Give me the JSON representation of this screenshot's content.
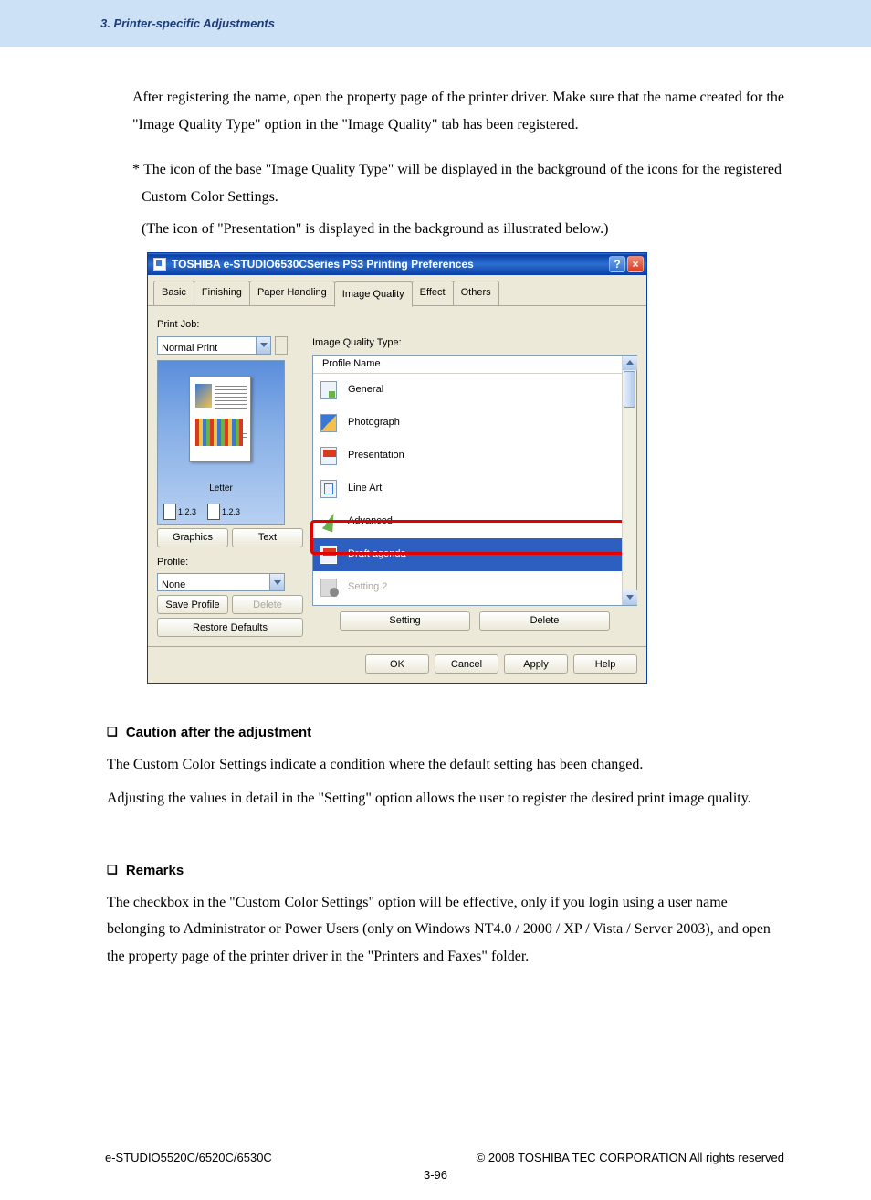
{
  "header": {
    "section": "3. Printer-specific Adjustments"
  },
  "body": {
    "para1": "After registering the name, open the property page of the printer driver.  Make sure that the name created for the \"Image Quality Type\" option in the \"Image Quality\" tab has been registered.",
    "star": "*",
    "para2a": "The icon of the base \"Image Quality Type\" will be displayed in the background of the icons for the registered Custom Color Settings.",
    "para2b": "(The icon of \"Presentation\" is displayed in the background as illustrated below.)"
  },
  "dialog": {
    "title": "TOSHIBA e-STUDIO6530CSeries PS3 Printing Preferences",
    "help_btn": "?",
    "close_btn": "×",
    "tabs": [
      "Basic",
      "Finishing",
      "Paper Handling",
      "Image Quality",
      "Effect",
      "Others"
    ],
    "active_tab_index": 3,
    "printjob_label": "Print Job:",
    "printjob_value": "Normal Print",
    "preview_paper": "Letter",
    "preview_thumbs": [
      "1.2.3",
      "1.2.3"
    ],
    "graphics_btn": "Graphics",
    "text_btn": "Text",
    "profile_label": "Profile:",
    "profile_value": "None",
    "save_profile_btn": "Save Profile",
    "delete_profile_btn": "Delete",
    "restore_btn": "Restore Defaults",
    "iqt_label": "Image Quality Type:",
    "list_header": "Profile Name",
    "items": [
      {
        "label": "General"
      },
      {
        "label": "Photograph"
      },
      {
        "label": "Presentation"
      },
      {
        "label": "Line Art"
      },
      {
        "label": "Advanced"
      },
      {
        "label": "Draft agenda"
      },
      {
        "label": "Setting 2"
      }
    ],
    "setting_btn": "Setting",
    "delete_iqt_btn": "Delete",
    "ok": "OK",
    "cancel": "Cancel",
    "apply": "Apply",
    "help": "Help"
  },
  "sections": {
    "caution_head": "Caution after the adjustment",
    "caution_body1": "The Custom Color Settings indicate a condition where the default setting has been changed.",
    "caution_body2": "Adjusting the values in detail in the \"Setting\" option allows the user to register the desired print image quality.",
    "remarks_head": "Remarks",
    "remarks_body": "The checkbox in the \"Custom Color Settings\" option will be effective, only if you login using a user name belonging to Administrator or Power Users (only on Windows NT4.0 / 2000 / XP / Vista / Server 2003), and open the property page of the printer driver in the \"Printers and Faxes\" folder."
  },
  "footer": {
    "left": "e-STUDIO5520C/6520C/6530C",
    "right": "© 2008 TOSHIBA TEC CORPORATION All rights reserved",
    "page": "3-96"
  }
}
